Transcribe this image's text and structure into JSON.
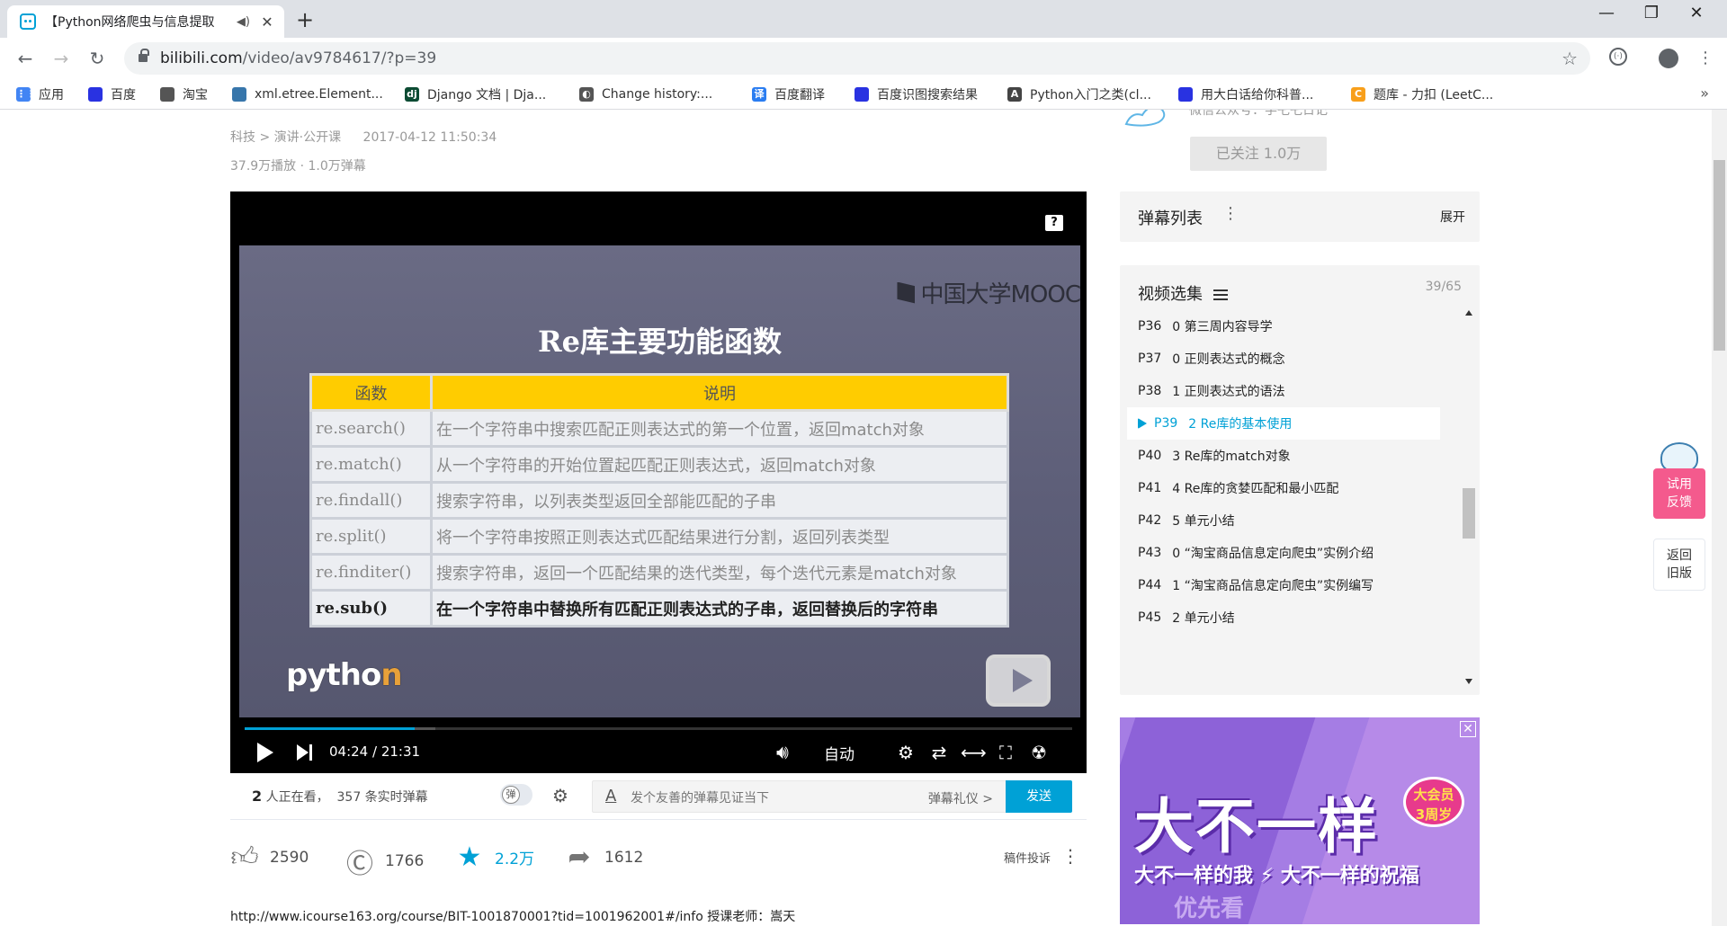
{
  "browser": {
    "tab_title": "【Python网络爬虫与信息提取",
    "url_host": "bilibili.com",
    "url_path": "/video/av9784617/?p=39",
    "bookmarks": [
      {
        "label": "应用",
        "color": "#4285f4"
      },
      {
        "label": "百度",
        "color": "#2932e1"
      },
      {
        "label": "淘宝",
        "color": "#555555"
      },
      {
        "label": "xml.etree.Element...",
        "color": "#3776ab"
      },
      {
        "label": "Django 文档 | Dja...",
        "color": "#0c4b33"
      },
      {
        "label": "Change history:...",
        "color": "#555555"
      },
      {
        "label": "百度翻译",
        "color": "#2a7df1"
      },
      {
        "label": "百度识图搜索结果",
        "color": "#2932e1"
      },
      {
        "label": "Python入门之类(cl...",
        "color": "#444444"
      },
      {
        "label": "用大白话给你科普...",
        "color": "#2932e1"
      },
      {
        "label": "题库 - 力扣 (LeetC...",
        "color": "#f89f1b"
      }
    ]
  },
  "video": {
    "category": "科技 > 演讲·公开课",
    "date": "2017-04-12 11:50:34",
    "stats": "37.9万播放 · 1.0万弹幕",
    "slide": {
      "logo": "中国大学MOOC",
      "title": "Re库主要功能函数",
      "headers": [
        "函数",
        "说明"
      ],
      "rows": [
        [
          "re.search()",
          "在一个字符串中搜索匹配正则表达式的第一个位置，返回match对象"
        ],
        [
          "re.match()",
          "从一个字符串的开始位置起匹配正则表达式，返回match对象"
        ],
        [
          "re.findall()",
          "搜索字符串，以列表类型返回全部能匹配的子串"
        ],
        [
          "re.split()",
          "将一个字符串按照正则表达式匹配结果进行分割，返回列表类型"
        ],
        [
          "re.finditer()",
          "搜索字符串，返回一个匹配结果的迭代类型，每个迭代元素是match对象"
        ],
        [
          "re.sub()",
          "在一个字符串中替换所有匹配正则表达式的子串，返回替换后的字符串"
        ]
      ],
      "python_logo_main": "pytho",
      "python_logo_accent": "n"
    },
    "current_time": "04:24",
    "duration": "21:31",
    "played_fraction": 0.205,
    "buffered_fraction": 0.23,
    "auto_label": "自动",
    "help_label": "?"
  },
  "danmaku": {
    "viewers_count": "2",
    "viewers_text": "人正在看，",
    "realtime_count": "357",
    "realtime_text": "条实时弹幕",
    "toggle_label": "弹",
    "placeholder": "发个友善的弹幕见证当下",
    "etiquette": "弹幕礼仪 >",
    "send": "发送"
  },
  "actions": {
    "like": "2590",
    "coin": "1766",
    "favorite": "2.2万",
    "share": "1612",
    "report": "稿件投诉"
  },
  "description": "http://www.icourse163.org/course/BIT-1001870001?tid=1001962001#/info 授课老师：嵩天",
  "uploader": {
    "subtitle": "微信公众号：学乇乇日记",
    "follow": "已关注 1.0万"
  },
  "danmaku_list": {
    "title": "弹幕列表",
    "expand": "展开"
  },
  "episodes": {
    "title": "视频选集",
    "count": "39/65",
    "items": [
      {
        "p": "P36",
        "title": "0 第三周内容导学"
      },
      {
        "p": "P37",
        "title": "0 正则表达式的概念"
      },
      {
        "p": "P38",
        "title": "1 正则表达式的语法"
      },
      {
        "p": "P39",
        "title": "2 Re库的基本使用"
      },
      {
        "p": "P40",
        "title": "3 Re库的match对象"
      },
      {
        "p": "P41",
        "title": "4 Re库的贪婪匹配和最小匹配"
      },
      {
        "p": "P42",
        "title": "5 单元小结"
      },
      {
        "p": "P43",
        "title": "0 “淘宝商品信息定向爬虫”实例介绍"
      },
      {
        "p": "P44",
        "title": "1 “淘宝商品信息定向爬虫”实例编写"
      },
      {
        "p": "P45",
        "title": "2 单元小结"
      }
    ]
  },
  "ad": {
    "main": "大不一样",
    "badge_line1": "大会员",
    "badge_line2": "3周岁",
    "sub": "大不一样的我 ⚡ 大不一样的祝福",
    "foot": "优先看"
  },
  "side": {
    "try_feedback_1": "试用",
    "try_feedback_2": "反馈",
    "back_old_1": "返回",
    "back_old_2": "旧版"
  }
}
